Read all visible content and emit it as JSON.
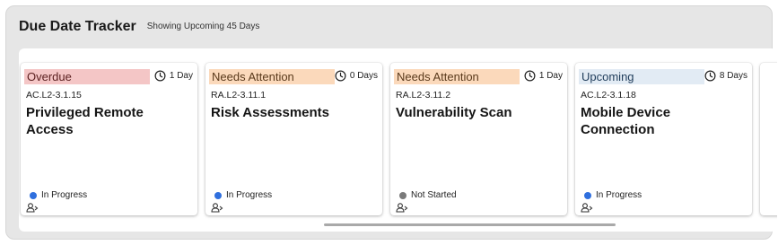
{
  "header": {
    "title": "Due Date Tracker",
    "subtitle": "Showing Upcoming 45 Days"
  },
  "colors": {
    "overdue_badge": "#f4c6c6",
    "attention_badge": "#fbd9bb",
    "upcoming_badge": "#e2ebf4",
    "in_progress_dot": "#2f6fde",
    "not_started_dot": "#7a7a7a"
  },
  "cards": [
    {
      "status_label": "Overdue",
      "days": "1 Day",
      "code": "AC.L2-3.1.15",
      "name": "Privileged Remote Access",
      "progress": "In Progress",
      "icons": [
        "clock-icon",
        "assignee-icon"
      ]
    },
    {
      "status_label": "Needs Attention",
      "days": "0 Days",
      "code": "RA.L2-3.11.1",
      "name": "Risk Assessments",
      "progress": "In Progress",
      "icons": [
        "clock-icon",
        "assignee-icon"
      ]
    },
    {
      "status_label": "Needs Attention",
      "days": "1 Day",
      "code": "RA.L2-3.11.2",
      "name": "Vulnerability Scan",
      "progress": "Not Started",
      "icons": [
        "clock-icon",
        "assignee-icon"
      ]
    },
    {
      "status_label": "Upcoming",
      "days": "8 Days",
      "code": "AC.L2-3.1.18",
      "name": "Mobile Device Connection",
      "progress": "In Progress",
      "icons": [
        "clock-icon",
        "assignee-icon"
      ]
    }
  ]
}
